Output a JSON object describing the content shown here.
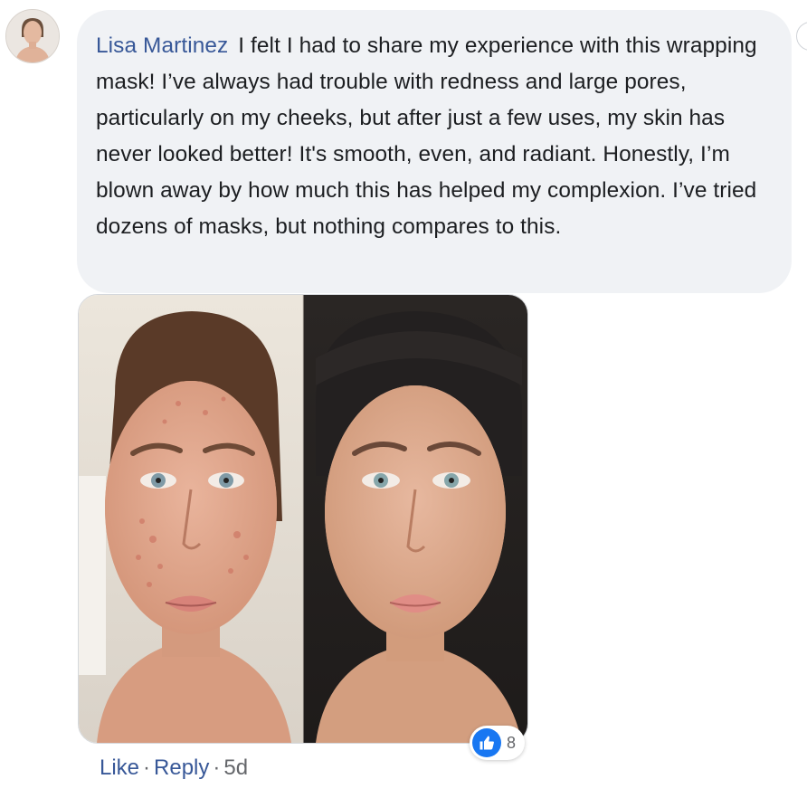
{
  "comment": {
    "author": "Lisa Martinez",
    "text": "I felt I had to share my experience with this wrapping mask! I’ve always had trouble with redness and large pores, particularly on my cheeks, but after just a few uses, my skin has never looked better! It's smooth, even, and radiant. Honestly, I’m blown away by how much this has helped my complexion. I’ve tried dozens of masks, but nothing compares to this."
  },
  "reactions": {
    "icon": "thumbs-up-icon",
    "count": "8",
    "color": "#1877f2"
  },
  "actions": {
    "like_label": "Like",
    "separator": "·",
    "reply_label": "Reply",
    "timestamp": "5d"
  },
  "colors": {
    "link": "#385898",
    "bubble": "#f0f2f5",
    "text": "#1c1e21",
    "meta": "#65676b"
  }
}
